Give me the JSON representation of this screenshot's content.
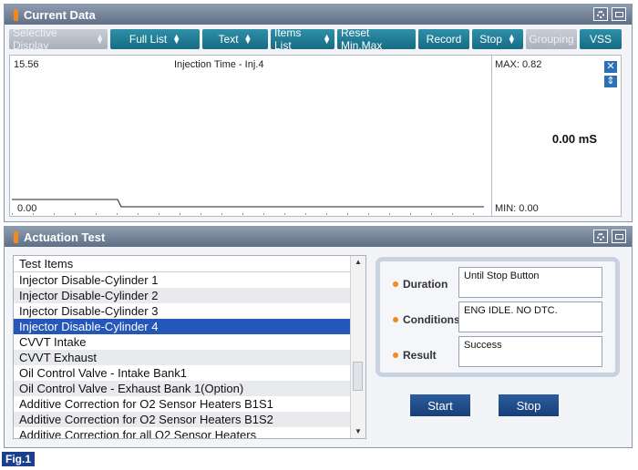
{
  "current_data": {
    "title": "Current Data",
    "toolbar": [
      {
        "label": "Selective Display",
        "spinner": true,
        "disabled": true
      },
      {
        "label": "Full List",
        "spinner": true,
        "disabled": false
      },
      {
        "label": "Text",
        "spinner": true,
        "disabled": false
      },
      {
        "label": "Items List",
        "spinner": true,
        "disabled": false
      },
      {
        "label": "Reset Min.Max",
        "spinner": false,
        "disabled": false
      },
      {
        "label": "Record",
        "spinner": false,
        "disabled": false
      },
      {
        "label": "Stop",
        "spinner": true,
        "disabled": false
      },
      {
        "label": "Grouping",
        "spinner": false,
        "disabled": true
      },
      {
        "label": "VSS",
        "spinner": false,
        "disabled": false
      }
    ],
    "graph": {
      "y_top": "15.56",
      "y_bottom": "0.00",
      "item_name": "Injection Time - Inj.4",
      "max_label": "MAX: 0.82",
      "min_label": "MIN: 0.00",
      "current_value": "0.00 mS"
    }
  },
  "actuation_test": {
    "title": "Actuation Test",
    "list_header": "Test Items",
    "items": [
      "Injector Disable-Cylinder 1",
      "Injector Disable-Cylinder 2",
      "Injector Disable-Cylinder 3",
      "Injector Disable-Cylinder 4",
      "CVVT Intake",
      "CVVT Exhaust",
      "Oil Control Valve - Intake Bank1",
      "Oil Control Valve - Exhaust Bank 1(Option)",
      "Additive Correction for O2 Sensor Heaters B1S1",
      "Additive Correction for O2 Sensor Heaters B1S2",
      "Additive Correction for all O2 Sensor Heaters"
    ],
    "selected_index": 3,
    "info": {
      "duration_label": "Duration",
      "duration_value": "Until Stop Button",
      "conditions_label": "Conditions",
      "conditions_value": "ENG IDLE. NO DTC.",
      "result_label": "Result",
      "result_value": "Success"
    },
    "start_label": "Start",
    "stop_label": "Stop"
  },
  "figure_label": "Fig.1",
  "colors": {
    "accent": "#1b7a93",
    "selection": "#2457b8",
    "title_mark": "#f08a1c"
  }
}
